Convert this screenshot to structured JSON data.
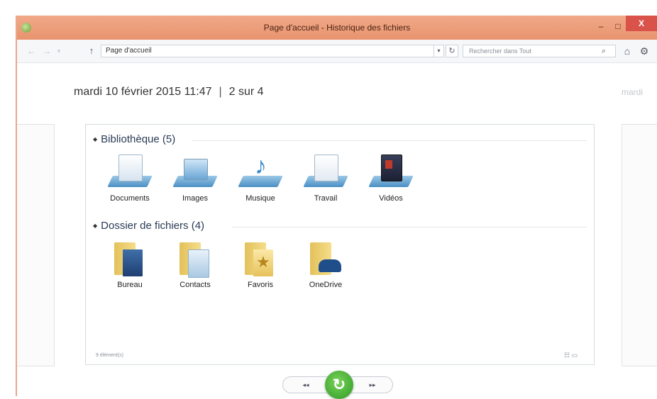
{
  "window": {
    "title": "Page d'accueil - Historique des fichiers",
    "minimize_glyph": "–",
    "maximize_glyph": "□",
    "close_glyph": "X"
  },
  "nav": {
    "back_glyph": "←",
    "forward_glyph": "→",
    "dropdown_glyph": "▾",
    "up_glyph": "↑",
    "address": "Page d'accueil",
    "search_placeholder": "Rechercher dans Tout",
    "refresh_glyph": "↻",
    "search_glyph": "⌕",
    "home_glyph": "⌂",
    "settings_glyph": "⚙"
  },
  "snapshot": {
    "date": "mardi 10 février 2015 11:47",
    "separator": "|",
    "position": "2 sur 4",
    "next_date_partial": "mardi"
  },
  "groups": [
    {
      "header": "Bibliothèque (5)",
      "items": [
        {
          "label": "Documents",
          "icon": "documents-library-icon"
        },
        {
          "label": "Images",
          "icon": "images-library-icon"
        },
        {
          "label": "Musique",
          "icon": "music-library-icon"
        },
        {
          "label": "Travail",
          "icon": "work-library-icon"
        },
        {
          "label": "Vidéos",
          "icon": "videos-library-icon"
        }
      ]
    },
    {
      "header": "Dossier de fichiers (4)",
      "items": [
        {
          "label": "Bureau",
          "icon": "desktop-folder-icon"
        },
        {
          "label": "Contacts",
          "icon": "contacts-folder-icon"
        },
        {
          "label": "Favoris",
          "icon": "favorites-folder-icon"
        },
        {
          "label": "OneDrive",
          "icon": "onedrive-folder-icon"
        }
      ]
    }
  ],
  "status": {
    "item_count": "9 élément(s)",
    "view_icons": "☷ ▭"
  },
  "controls": {
    "prev_glyph": "◂◂",
    "next_glyph": "▸▸",
    "restore_glyph": "↻"
  },
  "colors": {
    "title_bar": "#e8946e",
    "close_button": "#d9534a",
    "restore_button": "#2b9a22",
    "folder": "#f5dd8a",
    "library": "#4a8fc4"
  }
}
